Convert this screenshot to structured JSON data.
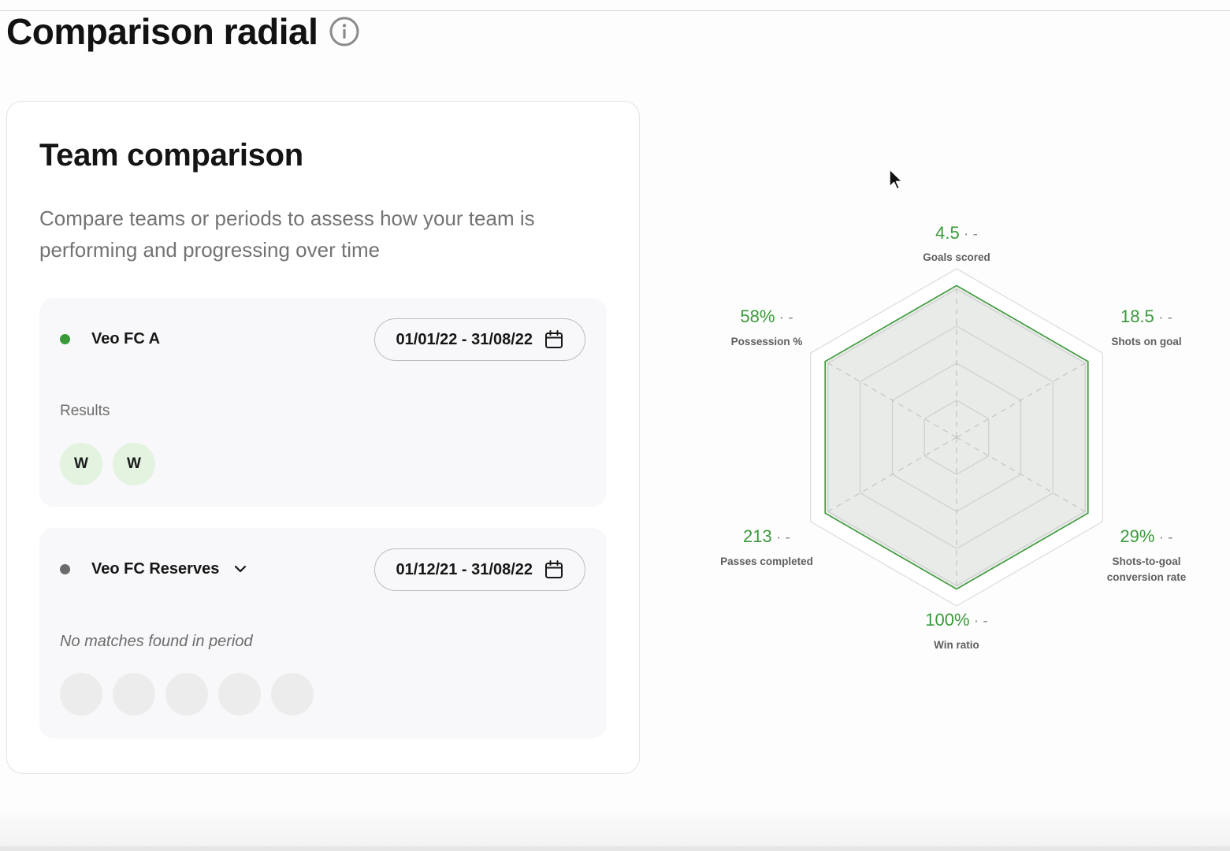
{
  "page": {
    "title": "Comparison radial"
  },
  "card": {
    "title": "Team comparison",
    "description": "Compare teams or periods to assess how your team is performing and progressing over time"
  },
  "team_a": {
    "name": "Veo FC A",
    "dot_color": "#3a9a3a",
    "date_range": "01/01/22 - 31/08/22",
    "results_label": "Results",
    "results": [
      "W",
      "W"
    ]
  },
  "team_b": {
    "name": "Veo FC Reserves",
    "dot_color": "#6b6b6b",
    "date_range": "01/12/21 - 31/08/22",
    "empty_message": "No matches found in period",
    "empty_slots": 5
  },
  "chart_data": {
    "type": "radar",
    "axes": [
      "Goals scored",
      "Shots on goal",
      "Shots-to-goal conversion rate",
      "Win ratio",
      "Passes completed",
      "Possession %"
    ],
    "axis_display_lines": [
      [
        "Goals scored"
      ],
      [
        "Shots on goal"
      ],
      [
        "Shots-to-goal",
        "conversion rate"
      ],
      [
        "Win ratio"
      ],
      [
        "Passes completed"
      ],
      [
        "Possession %"
      ]
    ],
    "series": [
      {
        "name": "Veo FC A",
        "display_values": [
          "4.5",
          "18.5",
          "29%",
          "100%",
          "213",
          "58%"
        ],
        "normalized": [
          0.9,
          0.9,
          0.9,
          0.9,
          0.9,
          0.9
        ],
        "color": "#3a9a3a"
      },
      {
        "name": "Veo FC Reserves",
        "display_values": [
          "-",
          "-",
          "-",
          "-",
          "-",
          "-"
        ]
      }
    ],
    "separator": " · ",
    "value_color": "#3a9a3a",
    "rings": 4
  }
}
